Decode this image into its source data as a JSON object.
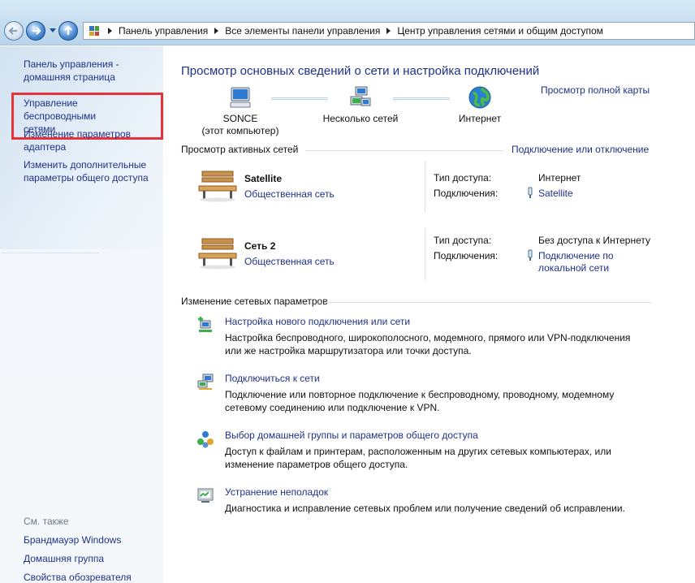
{
  "breadcrumbs": [
    "Панель управления",
    "Все элементы панели управления",
    "Центр управления сетями и общим доступом"
  ],
  "sidebar": {
    "links": [
      "Панель управления -",
      "домашняя страница",
      "Управление беспроводными",
      "сетями",
      "Изменение параметров",
      "адаптера",
      "Изменить дополнительные",
      "параметры общего доступа"
    ],
    "see_also_label": "См. также",
    "see_also": [
      "Брандмауэр Windows",
      "Домашняя группа",
      "Свойства обозревателя"
    ]
  },
  "main": {
    "title": "Просмотр основных сведений о сети и настройка подключений",
    "full_map_link": "Просмотр полной карты",
    "map": {
      "computer_line1": "SONCE",
      "computer_line2": "(этот компьютер)",
      "networks": "Несколько сетей",
      "internet": "Интернет"
    },
    "active_header": "Просмотр активных сетей",
    "connect_link": "Подключение или отключение",
    "active_networks": [
      {
        "name": "Satellite",
        "type": "Общественная сеть",
        "access_label": "Тип доступа:",
        "access_value": "Интернет",
        "conn_label": "Подключения:",
        "conn_value_1": "Satellite",
        "conn_value_2": ""
      },
      {
        "name": "Сеть  2",
        "type": "Общественная сеть",
        "access_label": "Тип доступа:",
        "access_value": "Без доступа к Интернету",
        "conn_label": "Подключения:",
        "conn_value_1": "Подключение по",
        "conn_value_2": "локальной сети"
      }
    ],
    "change_header": "Изменение сетевых параметров",
    "tasks": [
      {
        "title": "Настройка нового подключения или сети",
        "desc1": "Настройка беспроводного, широкополосного, модемного, прямого или VPN-подключения",
        "desc2": "или же настройка маршрутизатора или точки доступа."
      },
      {
        "title": "Подключиться к сети",
        "desc1": "Подключение или повторное подключение к беспроводному, проводному, модемному",
        "desc2": "сетевому соединению или подключение к VPN."
      },
      {
        "title": "Выбор домашней группы и параметров общего доступа",
        "desc1": "Доступ к файлам и принтерам, расположенным на других сетевых компьютерах, или",
        "desc2": "изменение параметров общего доступа."
      },
      {
        "title": "Устранение неполадок",
        "desc1": "Диагностика и исправление сетевых проблем или получение сведений об исправлении.",
        "desc2": ""
      }
    ]
  },
  "colors": {
    "link": "#1e3287",
    "highlight_border": "#e8323a"
  }
}
